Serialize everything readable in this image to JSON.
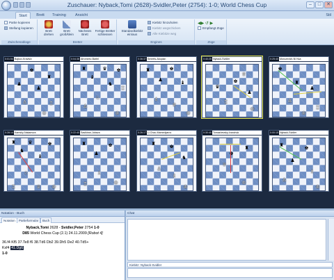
{
  "window": {
    "title": "Zuschauer: Nyback,Tomi (2628)-Svidler,Peter (2754): 1-0; World Chess Cup",
    "controls": [
      "–",
      "□",
      "✕"
    ]
  },
  "ribbon_tabs": [
    "Start",
    "Brett",
    "Training",
    "Ansicht"
  ],
  "style_menu": "Stil",
  "ribbon": {
    "clipboard": {
      "label": "Zwischenablage",
      "items": [
        "Partie kopieren",
        "Stellung kopieren"
      ]
    },
    "board": {
      "label": "Bretter",
      "buttons": [
        "Brett drehen",
        "Brett groß/klein",
        "Nächstes Brett",
        "Fertige Bretter schliessen"
      ]
    },
    "engines": {
      "label": "Engines",
      "button": "Standardkiebitz ein/aus",
      "items": [
        "Kiebitz hinzuholen",
        "Kiebitz wegschicken",
        "Alle Kiebitze weg"
      ]
    },
    "moves": {
      "label": "Züge",
      "checkbox": "Empfangt Züge"
    }
  },
  "boards": [
    {
      "clock": "0:01:54",
      "clock2": "0:00:05",
      "players": "Bojkov-Kravtsiv"
    },
    {
      "clock": "0:04:38",
      "clock2": "0:13:38",
      "players": "Afromeev-Bartel"
    },
    {
      "clock": "0:36:37",
      "clock2": "0:26:31",
      "players": "Smeets-Akopian"
    },
    {
      "clock": "0:40:25",
      "clock2": "0:33:10",
      "players": "Nyback-Svidler"
    },
    {
      "clock": "0:25:40",
      "clock2": "0:59:45",
      "players": "Morozevich-Ni Hua"
    },
    {
      "clock": "0:28:14",
      "clock2": "0:25:55",
      "players": "Kamsky-Nakamura"
    },
    {
      "clock": "0:22:40",
      "clock2": "0:23:04",
      "players": "Sasikiran-Jobava"
    },
    {
      "clock": "0:26:17",
      "clock2": "0:14:36",
      "players": "Li Chao-Mamedyarov"
    },
    {
      "clock": "0:30:40",
      "clock2": "0:40:30",
      "players": "Tomashevsky-Ivanchuk"
    },
    {
      "clock": "0:00:15",
      "clock2": "0:34:46",
      "players": "Nyback-Svidler"
    }
  ],
  "notation": {
    "header": "Notation - Buch",
    "tabs": [
      "Notation",
      "Partieformular",
      "Buch"
    ],
    "white": "Nyback,Tomi",
    "white_elo": "2628",
    "black": "Svidler,Peter",
    "black_elo": "2754",
    "result": "1-0",
    "eco": "D85",
    "event": "World Chess Cup (2.1) 24.11.2009",
    "annotator": "[Robot 4]",
    "moves_line1": "36.f4 Kf5 37.Te8 f6 38.Td6 Db2 39.Dh5 De2 40.Td5+",
    "moves_line2_prefix": "Kxf4",
    "moves_line2_highlight": "41.Dg6",
    "final": "1-0"
  },
  "chat": {
    "header": "Chat",
    "input_value": "Kiebitz: Nyback-Svidler"
  }
}
